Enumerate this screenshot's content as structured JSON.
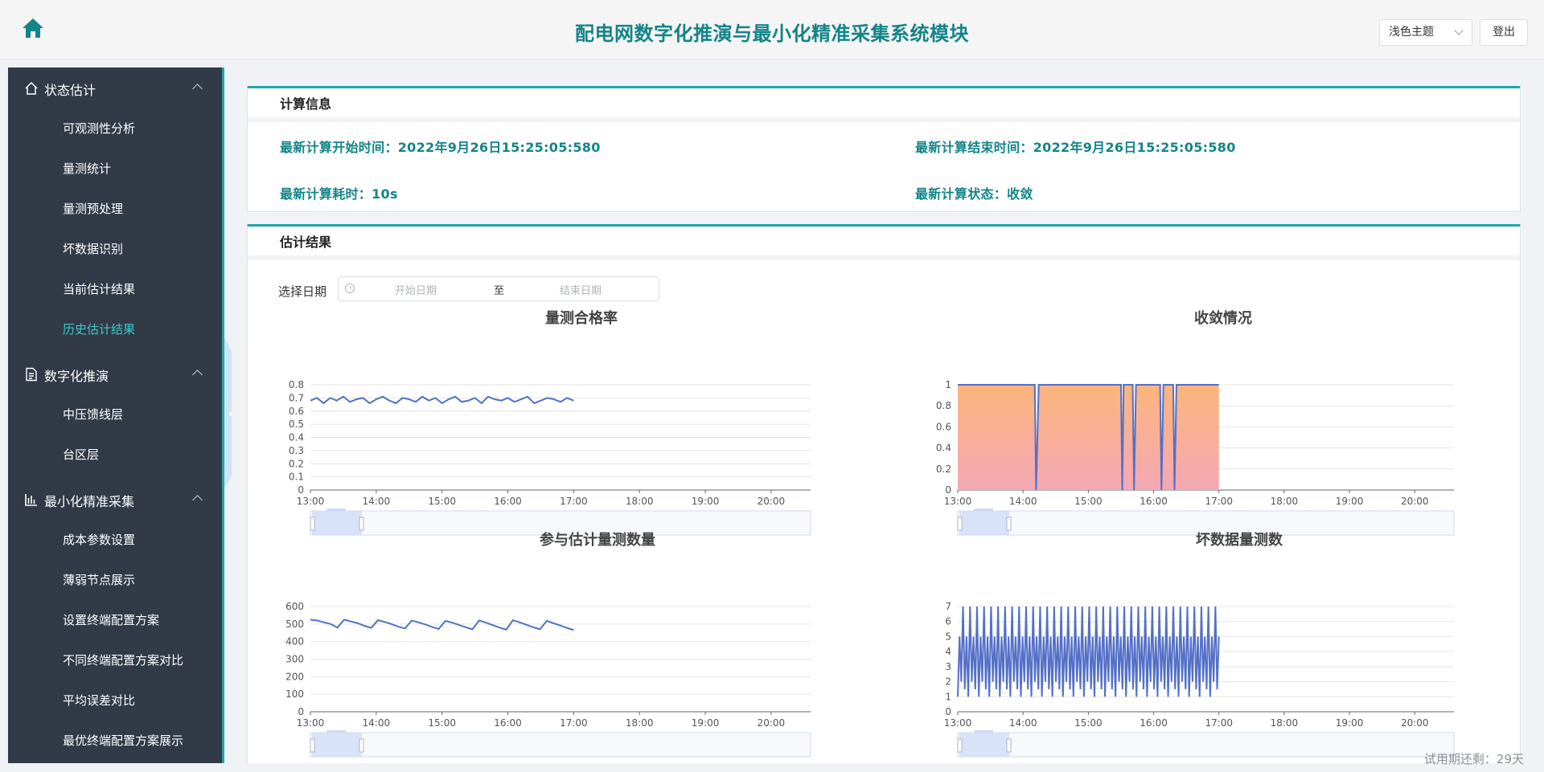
{
  "header": {
    "title": "配电网数字化推演与最小化精准采集系统模块",
    "theme_select": "浅色主题",
    "logout": "登出"
  },
  "sidebar": {
    "groups": [
      {
        "label": "状态估计",
        "icon": "home-outline-icon",
        "items": [
          "可观测性分析",
          "量测统计",
          "量测预处理",
          "坏数据识别",
          "当前估计结果",
          "历史估计结果"
        ]
      },
      {
        "label": "数字化推演",
        "icon": "document-icon",
        "items": [
          "中压馈线层",
          "台区层"
        ]
      },
      {
        "label": "最小化精准采集",
        "icon": "bar-chart-icon",
        "items": [
          "成本参数设置",
          "薄弱节点展示",
          "设置终端配置方案",
          "不同终端配置方案对比",
          "平均误差对比",
          "最优终端配置方案展示"
        ]
      }
    ],
    "active_item": "历史估计结果"
  },
  "calc_info": {
    "title": "计算信息",
    "start_time": "最新计算开始时间：2022年9月26日15:25:05:580",
    "end_time": "最新计算结束时间：2022年9月26日15:25:05:580",
    "duration": "最新计算耗时：10s",
    "status": "最新计算状态：收敛"
  },
  "estimate": {
    "title": "估计结果",
    "date_label": "选择日期",
    "start_placeholder": "开始日期",
    "range_separator": "至",
    "end_placeholder": "结束日期"
  },
  "trial_notice": "试用期还剩：29天",
  "colors": {
    "accent": "#1fa7a7",
    "title": "#138489",
    "sidebar_bg": "#323a48",
    "series": "#5470c6",
    "area_top": "#fbb57b",
    "area_bottom": "#f4a8b5"
  },
  "chart_data": [
    {
      "type": "line",
      "title": "量测合格率",
      "x_ticks": [
        "13:00",
        "14:00",
        "15:00",
        "16:00",
        "17:00",
        "18:00",
        "19:00",
        "20:00"
      ],
      "ylim": [
        0,
        0.8
      ],
      "y_ticks": [
        "0",
        "0.1",
        "0.2",
        "0.3",
        "0.4",
        "0.5",
        "0.6",
        "0.7",
        "0.8"
      ],
      "series": [
        {
          "x_start": "13:00",
          "x_end": "17:00",
          "approx_values": [
            0.68,
            0.7,
            0.66,
            0.7,
            0.68,
            0.71,
            0.67,
            0.69,
            0.7,
            0.66,
            0.69,
            0.71,
            0.68,
            0.66,
            0.7,
            0.69,
            0.67,
            0.71,
            0.68,
            0.7,
            0.66,
            0.69,
            0.71,
            0.67,
            0.68,
            0.7,
            0.66,
            0.71,
            0.69,
            0.68,
            0.7,
            0.67,
            0.69,
            0.71,
            0.66,
            0.68,
            0.7,
            0.69,
            0.67,
            0.7,
            0.68
          ]
        }
      ],
      "datazoom": true
    },
    {
      "type": "area",
      "title": "收敛情况",
      "x_ticks": [
        "13:00",
        "14:00",
        "15:00",
        "16:00",
        "17:00",
        "18:00",
        "19:00",
        "20:00"
      ],
      "ylim": [
        0,
        1
      ],
      "y_ticks": [
        "0",
        "0.2",
        "0.4",
        "0.6",
        "0.8",
        "1"
      ],
      "series": [
        {
          "x_start": "13:00",
          "x_end": "17:00",
          "values_desc": "1 with brief drops to 0 near 14:10, 15:32, 15:47, 16:13, 16:27",
          "points": [
            [
              0.0,
              1
            ],
            [
              1.18,
              1
            ],
            [
              1.2,
              0
            ],
            [
              1.24,
              1
            ],
            [
              2.5,
              1
            ],
            [
              2.52,
              0
            ],
            [
              2.54,
              1
            ],
            [
              2.68,
              1
            ],
            [
              2.7,
              0
            ],
            [
              2.73,
              1
            ],
            [
              3.1,
              1
            ],
            [
              3.12,
              0
            ],
            [
              3.15,
              1
            ],
            [
              3.3,
              1
            ],
            [
              3.32,
              0
            ],
            [
              3.35,
              1
            ],
            [
              4.0,
              1
            ]
          ]
        }
      ],
      "datazoom": true
    },
    {
      "type": "line",
      "title": "参与估计量测数量",
      "x_ticks": [
        "13:00",
        "14:00",
        "15:00",
        "16:00",
        "17:00",
        "18:00",
        "19:00",
        "20:00"
      ],
      "ylim": [
        0,
        600
      ],
      "y_ticks": [
        "0",
        "100",
        "200",
        "300",
        "400",
        "500",
        "600"
      ],
      "series": [
        {
          "x_start": "13:00",
          "x_end": "17:00",
          "approx_values": [
            525,
            520,
            510,
            500,
            480,
            525,
            515,
            505,
            490,
            478,
            522,
            512,
            500,
            485,
            475,
            520,
            510,
            498,
            484,
            472,
            518,
            508,
            495,
            482,
            470,
            520,
            508,
            494,
            480,
            468,
            522,
            510,
            496,
            482,
            470,
            518,
            505,
            492,
            478,
            466
          ]
        }
      ],
      "datazoom": true
    },
    {
      "type": "line",
      "title": "坏数据量测数",
      "x_ticks": [
        "13:00",
        "14:00",
        "15:00",
        "16:00",
        "17:00",
        "18:00",
        "19:00",
        "20:00"
      ],
      "ylim": [
        0,
        7
      ],
      "y_ticks": [
        "0",
        "1",
        "2",
        "3",
        "4",
        "5",
        "6",
        "7"
      ],
      "series": [
        {
          "x_start": "13:00",
          "x_end": "17:00",
          "values_desc": "rapid oscillation between 1 and 7"
        }
      ],
      "datazoom": true
    }
  ]
}
